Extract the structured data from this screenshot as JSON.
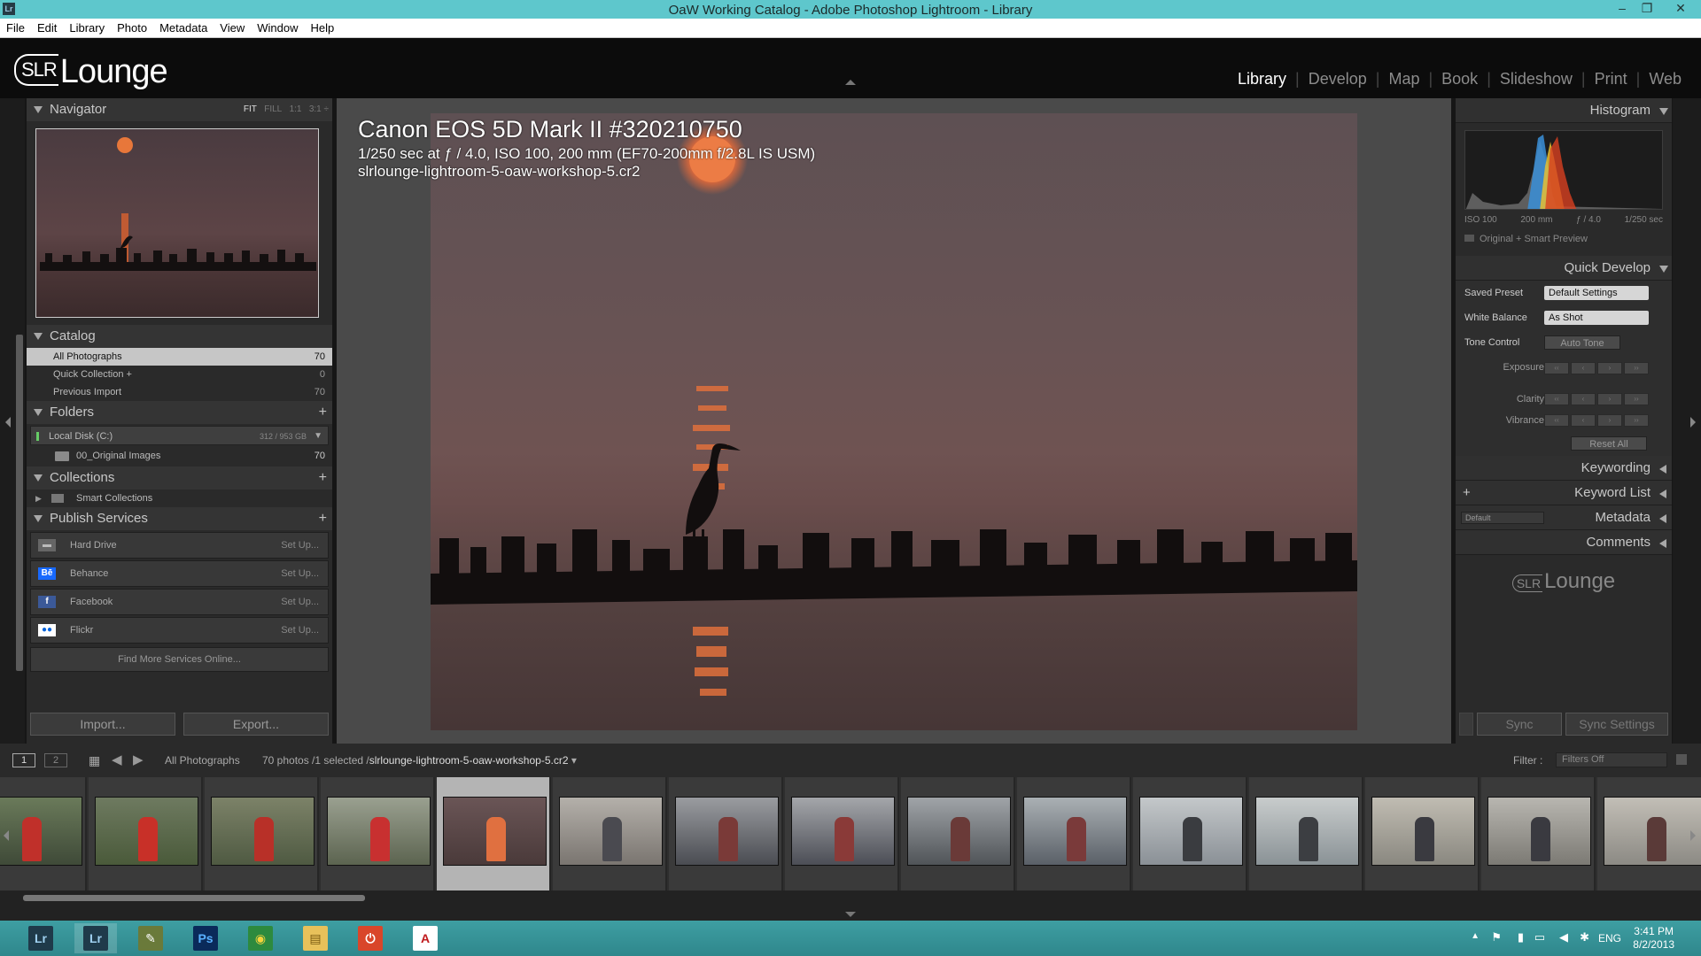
{
  "window": {
    "title": "OaW Working Catalog - Adobe Photoshop Lightroom - Library",
    "app_icon": "Lr",
    "minimize": "–",
    "restore": "❐",
    "close": "✕"
  },
  "menu": [
    "File",
    "Edit",
    "Library",
    "Photo",
    "Metadata",
    "View",
    "Window",
    "Help"
  ],
  "identity": {
    "logo_slr": "SLR",
    "logo_text": "Lounge"
  },
  "modules": [
    {
      "label": "Library",
      "active": true
    },
    {
      "label": "Develop"
    },
    {
      "label": "Map"
    },
    {
      "label": "Book"
    },
    {
      "label": "Slideshow"
    },
    {
      "label": "Print"
    },
    {
      "label": "Web"
    }
  ],
  "navigator": {
    "title": "Navigator",
    "fit": "FIT",
    "fill": "FILL",
    "one": "1:1",
    "three": "3:1 ÷"
  },
  "catalog": {
    "title": "Catalog",
    "items": [
      {
        "label": "All Photographs",
        "count": "70"
      },
      {
        "label": "Quick Collection  +",
        "count": "0"
      },
      {
        "label": "Previous Import",
        "count": "70"
      }
    ]
  },
  "folders": {
    "title": "Folders",
    "plus": "+",
    "disk": "Local Disk (C:)",
    "disk_space": "312 / 953 GB",
    "folder": "00_Original Images",
    "folder_count": "70"
  },
  "collections": {
    "title": "Collections",
    "plus": "+",
    "item": "Smart Collections"
  },
  "publish": {
    "title": "Publish Services",
    "plus": "+",
    "services": [
      {
        "label": "Hard Drive",
        "setup": "Set Up...",
        "icon": "hard-drive-icon",
        "glyph": "▬",
        "bg": "#666666",
        "fg": "#bbbbbb"
      },
      {
        "label": "Behance",
        "setup": "Set Up...",
        "icon": "behance-icon",
        "glyph": "Bē",
        "bg": "#1769ff",
        "fg": "#ffffff"
      },
      {
        "label": "Facebook",
        "setup": "Set Up...",
        "icon": "facebook-icon",
        "glyph": "f",
        "bg": "#3b5998",
        "fg": "#ffffff"
      },
      {
        "label": "Flickr",
        "setup": "Set Up...",
        "icon": "flickr-icon",
        "glyph": "●●",
        "bg": "#ffffff",
        "fg": "#0063dc"
      }
    ],
    "find_more": "Find More Services Online..."
  },
  "buttons": {
    "import": "Import...",
    "export": "Export..."
  },
  "photo_info": {
    "line1": "Canon EOS 5D Mark II #320210750",
    "line2": "1/250 sec at ƒ / 4.0, ISO 100, 200 mm (EF70-200mm f/2.8L IS USM)",
    "line3": "slrlounge-lightroom-5-oaw-workshop-5.cr2"
  },
  "histogram": {
    "title": "Histogram",
    "iso": "ISO 100",
    "focal": "200 mm",
    "aperture": "ƒ / 4.0",
    "shutter": "1/250 sec",
    "preview": "Original + Smart Preview"
  },
  "quick_develop": {
    "title": "Quick Develop",
    "saved_preset_label": "Saved Preset",
    "saved_preset_value": "Default Settings",
    "wb_label": "White Balance",
    "wb_value": "As Shot",
    "tone_label": "Tone Control",
    "auto_tone": "Auto Tone",
    "exposure": "Exposure",
    "clarity": "Clarity",
    "vibrance": "Vibrance",
    "reset": "Reset All",
    "step_glyphs": [
      "‹‹",
      "‹",
      "›",
      "››"
    ]
  },
  "right_panels": {
    "keywording": "Keywording",
    "keyword_list": "Keyword List",
    "keyword_plus": "+",
    "metadata": "Metadata",
    "metadata_preset": "Default",
    "comments": "Comments",
    "logo_slr": "SLR",
    "logo_text": "Lounge"
  },
  "sync": {
    "sync": "Sync",
    "sync_settings": "Sync Settings"
  },
  "filmbar": {
    "page1": "1",
    "page2": "2",
    "source": "All Photographs",
    "status": "70 photos /1 selected /",
    "filename": "slrlounge-lightroom-5-oaw-workshop-5.cr2",
    "filter_label": "Filter :",
    "filter_value": "Filters Off"
  },
  "filmstrip": {
    "selected_index": 4,
    "count": 15
  },
  "taskbar": {
    "apps": [
      {
        "name": "lightroom-icon",
        "glyph": "Lr",
        "bg": "#1f3a4a",
        "fg": "#9fd0f0"
      },
      {
        "name": "lightroom-active-icon",
        "glyph": "Lr",
        "bg": "#1f3a4a",
        "fg": "#9fd0f0"
      },
      {
        "name": "tool-icon",
        "glyph": "✎",
        "bg": "#6a7a3a",
        "fg": "#ffffff"
      },
      {
        "name": "photoshop-icon",
        "glyph": "Ps",
        "bg": "#0a2a5a",
        "fg": "#58b0ff"
      },
      {
        "name": "chrome-icon",
        "glyph": "◉",
        "bg": "#2d8a3e",
        "fg": "#f5d33b"
      },
      {
        "name": "file-explorer-icon",
        "glyph": "▤",
        "bg": "#e8c15a",
        "fg": "#7a5a10"
      },
      {
        "name": "power-app-icon",
        "glyph": "⏻",
        "bg": "#d9462a",
        "fg": "#ffffff"
      },
      {
        "name": "acrobat-icon",
        "glyph": "A",
        "bg": "#ffffff",
        "fg": "#c0191c"
      }
    ],
    "lang": "ENG",
    "time": "3:41 PM",
    "date": "8/2/2013"
  }
}
